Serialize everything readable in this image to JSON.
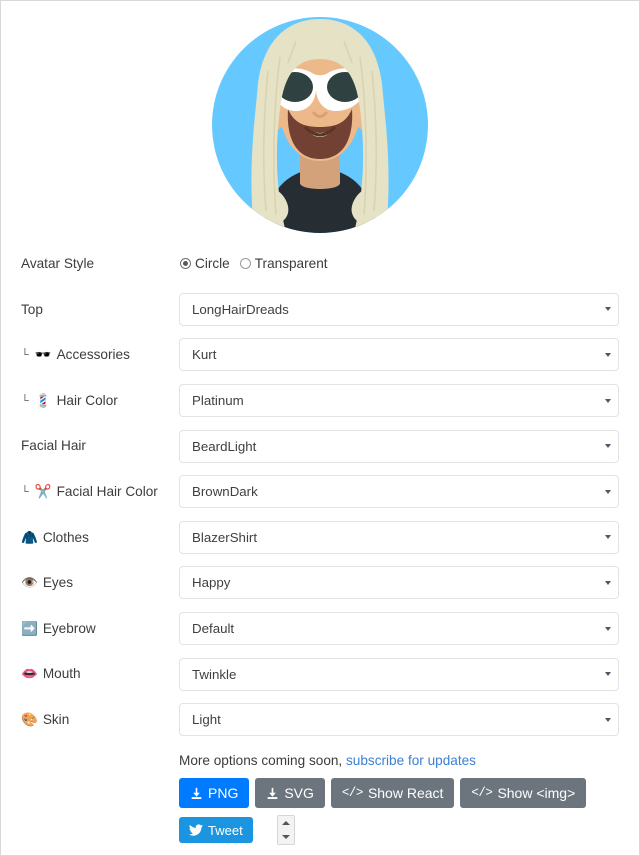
{
  "avatar": {
    "alt": "avataaars avatar preview",
    "background_color": "#65C9FF",
    "skin_color": "#EDB98A",
    "hair_color": "#E6E2C5",
    "facial_hair_color": "#724133",
    "clothes_color": "#262E33",
    "glasses_color": "#FFFFFF",
    "lens_color": "#2F4140"
  },
  "form": {
    "avatar_style": {
      "label": "Avatar Style",
      "options": [
        {
          "label": "Circle",
          "selected": true
        },
        {
          "label": "Transparent",
          "selected": false
        }
      ]
    },
    "rows": [
      {
        "label": "Top",
        "icon": "",
        "indent": false,
        "value": "LongHairDreads",
        "icon_name": ""
      },
      {
        "label": "Accessories",
        "icon": "🕶️",
        "indent": true,
        "value": "Kurt",
        "icon_name": "sunglasses-icon"
      },
      {
        "label": "Hair Color",
        "icon": "💈",
        "indent": true,
        "value": "Platinum",
        "icon_name": "barber-pole-icon"
      },
      {
        "label": "Facial Hair",
        "icon": "",
        "indent": false,
        "value": "BeardLight",
        "icon_name": ""
      },
      {
        "label": "Facial Hair Color",
        "icon": "✂️",
        "indent": true,
        "value": "BrownDark",
        "icon_name": "scissors-icon"
      },
      {
        "label": "Clothes",
        "icon": "🧥",
        "indent": false,
        "value": "BlazerShirt",
        "icon_name": "coat-icon"
      },
      {
        "label": "Eyes",
        "icon": "👁️",
        "indent": false,
        "value": "Happy",
        "icon_name": "eye-icon"
      },
      {
        "label": "Eyebrow",
        "icon": "➡️",
        "indent": false,
        "value": "Default",
        "icon_name": "eyebrow-icon"
      },
      {
        "label": "Mouth",
        "icon": "👄",
        "indent": false,
        "value": "Twinkle",
        "icon_name": "lips-icon"
      },
      {
        "label": "Skin",
        "icon": "🎨",
        "indent": false,
        "value": "Light",
        "icon_name": "palette-icon"
      }
    ],
    "indent_marker": "└"
  },
  "footer": {
    "more_text": "More options coming soon,",
    "subscribe_link": "subscribe for updates",
    "buttons": [
      {
        "label": "PNG",
        "icon": "download-icon",
        "style": "primary"
      },
      {
        "label": "SVG",
        "icon": "download-icon",
        "style": "secondary"
      },
      {
        "label": "Show React",
        "icon": "code-icon",
        "style": "secondary"
      },
      {
        "label": "Show <img>",
        "icon": "code-icon",
        "style": "secondary"
      }
    ],
    "tweet_label": "Tweet",
    "code_glyph": "</>"
  },
  "colors": {
    "primary": "#007bff",
    "secondary": "#6c757d",
    "twitter": "#1b95e0",
    "link": "#3b7fd4",
    "border": "#e3e3e3"
  }
}
